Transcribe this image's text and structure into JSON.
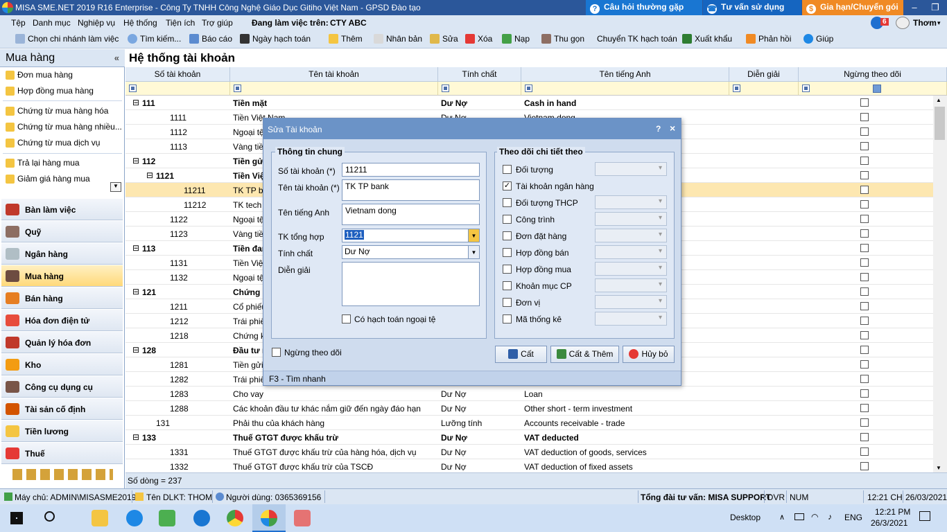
{
  "titlebar": {
    "title": "MISA SME.NET 2019 R16 Enterprise - Công Ty TNHH Công Nghệ Giáo Dục Gitiho Việt Nam - GPSD Đào tạo",
    "faq": "Câu hỏi thường gặp",
    "consult": "Tư vấn sử dụng",
    "renew": "Gia hạn/Chuyển gói",
    "notify_count": "6",
    "user": "Thơm"
  },
  "menu": [
    "Tệp",
    "Danh mục",
    "Nghiệp vụ",
    "Hệ thống",
    "Tiện ích",
    "Trợ giúp"
  ],
  "workspace": {
    "label": "Đang làm việc trên:",
    "company": "CTY ABC"
  },
  "toolbar": [
    "Chọn chi nhánh làm việc",
    "Tìm kiếm...",
    "Báo cáo",
    "Ngày hạch toán",
    "Thêm",
    "Nhân bản",
    "Sửa",
    "Xóa",
    "Nạp",
    "Thu gọn",
    "Chuyển TK hạch toán",
    "Xuất khẩu",
    "Phản hồi",
    "Giúp"
  ],
  "sidebar": {
    "title": "Mua hàng",
    "items": [
      "Đơn mua hàng",
      "Hợp đồng mua hàng",
      "Chứng từ mua hàng hóa",
      "Chứng từ mua hàng nhiều...",
      "Chứng từ mua dịch vụ",
      "Trả lại hàng mua",
      "Giảm giá hàng mua"
    ],
    "modules": [
      "Bàn làm việc",
      "Quỹ",
      "Ngân hàng",
      "Mua hàng",
      "Bán hàng",
      "Hóa đơn điện tử",
      "Quản lý hóa đơn",
      "Kho",
      "Công cụ dụng cụ",
      "Tài sản cố định",
      "Tiền lương",
      "Thuế"
    ]
  },
  "content": {
    "title": "Hệ thống tài khoản",
    "columns": [
      "Số tài khoản",
      "Tên tài khoản",
      "Tính chất",
      "Tên tiếng Anh",
      "Diễn giải",
      "Ngừng theo dõi"
    ],
    "rows": [
      {
        "code": "111",
        "name": "Tiền mặt",
        "prop": "Dư Nợ",
        "en": "Cash in hand",
        "bold": true,
        "lvl": 0,
        "exp": true
      },
      {
        "code": "1111",
        "name": "Tiền Việt Nam",
        "prop": "Dư Nợ",
        "en": "Vietnam dong",
        "lvl": 1
      },
      {
        "code": "1112",
        "name": "Ngoại tệ",
        "prop": "",
        "en": "",
        "lvl": 1
      },
      {
        "code": "1113",
        "name": "Vàng tiền tệ",
        "prop": "",
        "en": "",
        "lvl": 1
      },
      {
        "code": "112",
        "name": "Tiền gửi Ngân hàng",
        "prop": "",
        "en": "",
        "bold": true,
        "lvl": 0,
        "exp": true
      },
      {
        "code": "1121",
        "name": "Tiền Việt Nam",
        "prop": "",
        "en": "",
        "bold": true,
        "lvl": 1,
        "exp": true
      },
      {
        "code": "11211",
        "name": "TK TP bank",
        "prop": "",
        "en": "",
        "lvl": 2,
        "hl": true
      },
      {
        "code": "11212",
        "name": "TK tech",
        "prop": "",
        "en": "",
        "lvl": 2
      },
      {
        "code": "1122",
        "name": "Ngoại tệ",
        "prop": "",
        "en": "",
        "lvl": 1
      },
      {
        "code": "1123",
        "name": "Vàng tiền tệ",
        "prop": "",
        "en": "",
        "lvl": 1
      },
      {
        "code": "113",
        "name": "Tiền đang chuyển",
        "prop": "",
        "en": "",
        "bold": true,
        "lvl": 0,
        "exp": true
      },
      {
        "code": "1131",
        "name": "Tiền Việt Nam",
        "prop": "",
        "en": "",
        "lvl": 1
      },
      {
        "code": "1132",
        "name": "Ngoại tệ",
        "prop": "",
        "en": "",
        "lvl": 1
      },
      {
        "code": "121",
        "name": "Chứng khoán kinh doanh",
        "prop": "",
        "en": "",
        "bold": true,
        "lvl": 0,
        "exp": true
      },
      {
        "code": "1211",
        "name": "Cổ phiếu",
        "prop": "",
        "en": "",
        "lvl": 1
      },
      {
        "code": "1212",
        "name": "Trái phiếu",
        "prop": "",
        "en": "",
        "lvl": 1
      },
      {
        "code": "1218",
        "name": "Chứng khoán",
        "prop": "",
        "en": "",
        "lvl": 1
      },
      {
        "code": "128",
        "name": "Đầu tư nắm giữ",
        "prop": "",
        "en": "",
        "bold": true,
        "lvl": 0,
        "exp": true
      },
      {
        "code": "1281",
        "name": "Tiền gửi có kỳ hạn",
        "prop": "",
        "en": "",
        "lvl": 1
      },
      {
        "code": "1282",
        "name": "Trái phiếu",
        "prop": "",
        "en": "",
        "lvl": 1
      },
      {
        "code": "1283",
        "name": "Cho vay",
        "prop": "Dư Nợ",
        "en": "Loan",
        "lvl": 1
      },
      {
        "code": "1288",
        "name": "Các khoản đầu tư khác nắm giữ đến ngày đáo hạn",
        "prop": "Dư Nợ",
        "en": "Other short - term investment",
        "lvl": 1
      },
      {
        "code": "131",
        "name": "Phải thu của khách hàng",
        "prop": "Lưỡng tính",
        "en": "Accounts receivable - trade",
        "lvl": 0
      },
      {
        "code": "133",
        "name": "Thuế GTGT được khấu trừ",
        "prop": "Dư Nợ",
        "en": "VAT deducted",
        "bold": true,
        "lvl": 0,
        "exp": true
      },
      {
        "code": "1331",
        "name": "Thuế GTGT được khấu trừ của hàng hóa, dịch vụ",
        "prop": "Dư Nợ",
        "en": "VAT deduction of goods, services",
        "lvl": 1
      },
      {
        "code": "1332",
        "name": "Thuế GTGT được khấu trừ của TSCĐ",
        "prop": "Dư Nợ",
        "en": "VAT deduction of fixed assets",
        "lvl": 1
      }
    ],
    "row_count": "Số dòng = 237"
  },
  "dialog": {
    "title": "Sửa Tài khoản",
    "help": "?",
    "close": "×",
    "general_group": "Thông tin chung",
    "lbl_code": "Số tài khoản (*)",
    "val_code": "11211",
    "lbl_name": "Tên tài khoản (*)",
    "val_name": "TK TP bank",
    "lbl_en": "Tên tiếng Anh",
    "val_en": "Vietnam dong",
    "lbl_parent": "TK tổng hợp",
    "val_parent": "1121",
    "lbl_prop": "Tính chất",
    "val_prop": "Dư Nợ",
    "lbl_desc": "Diễn giải",
    "foreign": "Có hạch toán ngoại tệ",
    "stop": "Ngừng theo dõi",
    "track_group": "Theo dõi chi tiết theo",
    "track": [
      {
        "label": "Đối tượng",
        "checked": false,
        "combo": true
      },
      {
        "label": "Tài khoản ngân hàng",
        "checked": true,
        "combo": false
      },
      {
        "label": "Đối tượng THCP",
        "checked": false,
        "combo": true
      },
      {
        "label": "Công trình",
        "checked": false,
        "combo": true
      },
      {
        "label": "Đơn đặt hàng",
        "checked": false,
        "combo": true
      },
      {
        "label": "Hợp đồng bán",
        "checked": false,
        "combo": true
      },
      {
        "label": "Hợp đồng mua",
        "checked": false,
        "combo": true
      },
      {
        "label": "Khoản mục CP",
        "checked": false,
        "combo": true
      },
      {
        "label": "Đơn vị",
        "checked": false,
        "combo": true
      },
      {
        "label": "Mã thống kê",
        "checked": false,
        "combo": true
      }
    ],
    "btn_save": "Cất",
    "btn_save_add": "Cất & Thêm",
    "btn_cancel": "Hủy bỏ",
    "footer": "F3 - Tìm nhanh"
  },
  "statusbar": {
    "server": "Máy chủ: ADMIN\\MISASME2019",
    "db": "Tên DLKT: THOM",
    "user": "Người dùng: 0365369156",
    "hotline": "Tổng đài tư vấn: MISA SUPPORT",
    "ovr": "OVR",
    "num": "NUM",
    "time": "12:21 CH",
    "date": "26/03/2021"
  },
  "taskbar": {
    "desktop": "Desktop",
    "lang": "ENG",
    "clock_time": "12:21 PM",
    "clock_date": "26/3/2021"
  },
  "colors": {
    "title": "#2b579a",
    "accent": "#6b93c7",
    "highlight": "#fde7b0",
    "renew": "#f08a24"
  }
}
